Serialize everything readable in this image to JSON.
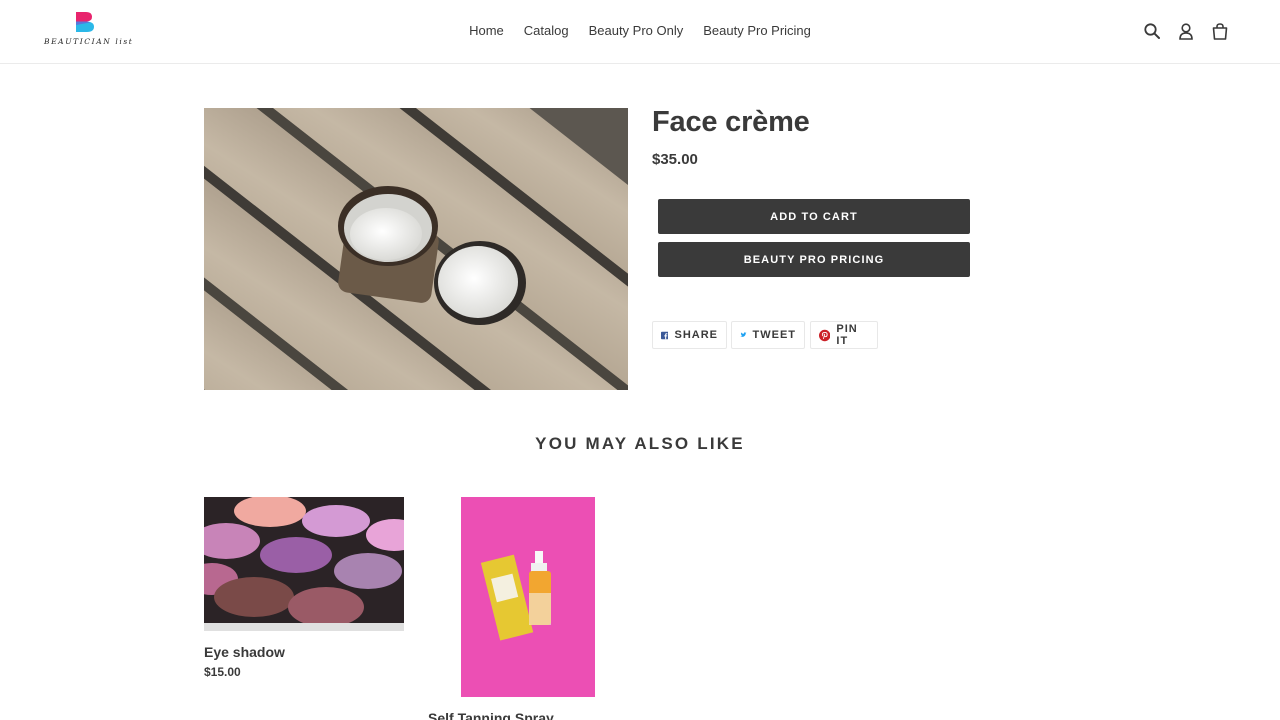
{
  "brand": {
    "name": "BEAUTICIAN list"
  },
  "nav": {
    "items": [
      "Home",
      "Catalog",
      "Beauty Pro Only",
      "Beauty Pro Pricing"
    ]
  },
  "header_icons": [
    "search-icon",
    "account-icon",
    "cart-icon"
  ],
  "product": {
    "title": "Face crème",
    "price": "$35.00",
    "add_to_cart_label": "ADD TO CART",
    "pro_pricing_label": "BEAUTY PRO PRICING"
  },
  "share": {
    "facebook_label": "SHARE",
    "twitter_label": "TWEET",
    "pinterest_label": "PIN IT"
  },
  "related": {
    "heading": "YOU MAY ALSO LIKE",
    "items": [
      {
        "name": "Eye shadow",
        "price": "$15.00"
      },
      {
        "name": "Self Tanning Spray",
        "price": ""
      }
    ]
  },
  "colors": {
    "button_bg": "#3a3a3a",
    "text": "#3a3a3a",
    "facebook": "#3b5998",
    "twitter": "#1da1f2",
    "pinterest": "#cb2027",
    "accent_pink": "#ec4fb4"
  }
}
